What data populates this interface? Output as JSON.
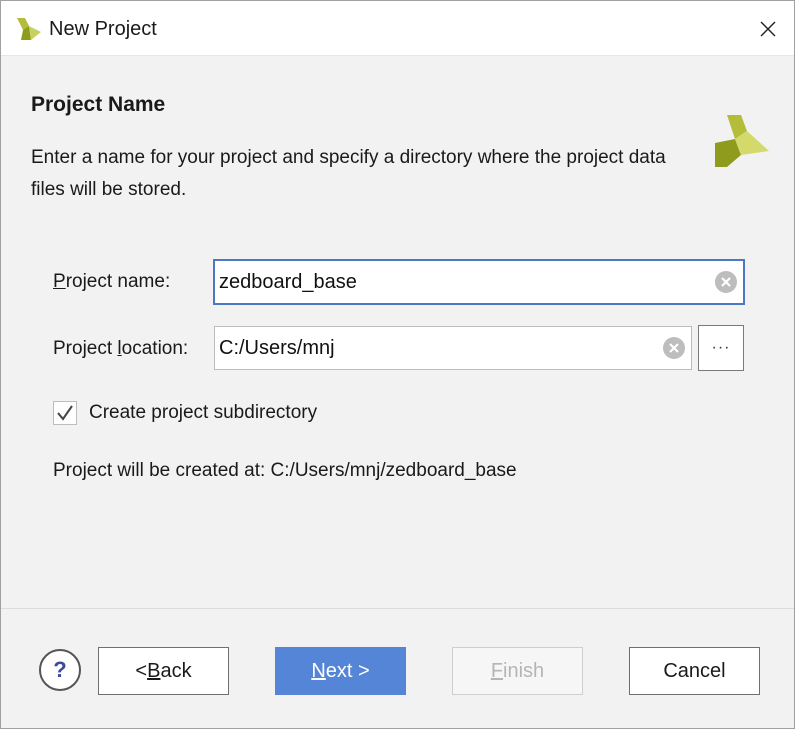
{
  "window": {
    "title": "New Project",
    "close_symbol": "✕"
  },
  "header": {
    "heading": "Project Name",
    "description": "Enter a name for your project and specify a directory where the project data files will be stored."
  },
  "form": {
    "project_name": {
      "label_pre": "P",
      "label_rest": "roject name:",
      "value": "zedboard_base"
    },
    "project_location": {
      "label_pre": "Project ",
      "label_u": "l",
      "label_rest": "ocation:",
      "value": "C:/Users/mnj",
      "browse_label": "···"
    },
    "subdirectory": {
      "label": "Create project subdirectory",
      "checked": true
    },
    "created_at": {
      "label": "Project will be created at:",
      "path": "C:/Users/mnj/zedboard_base"
    }
  },
  "footer": {
    "help_label": "?",
    "back": {
      "pre": "< ",
      "u": "B",
      "rest": "ack"
    },
    "next": {
      "u": "N",
      "rest": "ext >"
    },
    "finish": {
      "u": "F",
      "rest": "inish"
    },
    "cancel": {
      "label": "Cancel"
    }
  },
  "colors": {
    "accent": "#5585d6",
    "focus_border": "#4a78c2",
    "logo_green": "#9aa81f"
  },
  "icons": [
    "xilinx-logo-icon",
    "close-icon",
    "clear-icon",
    "checkmark-icon",
    "help-icon"
  ]
}
